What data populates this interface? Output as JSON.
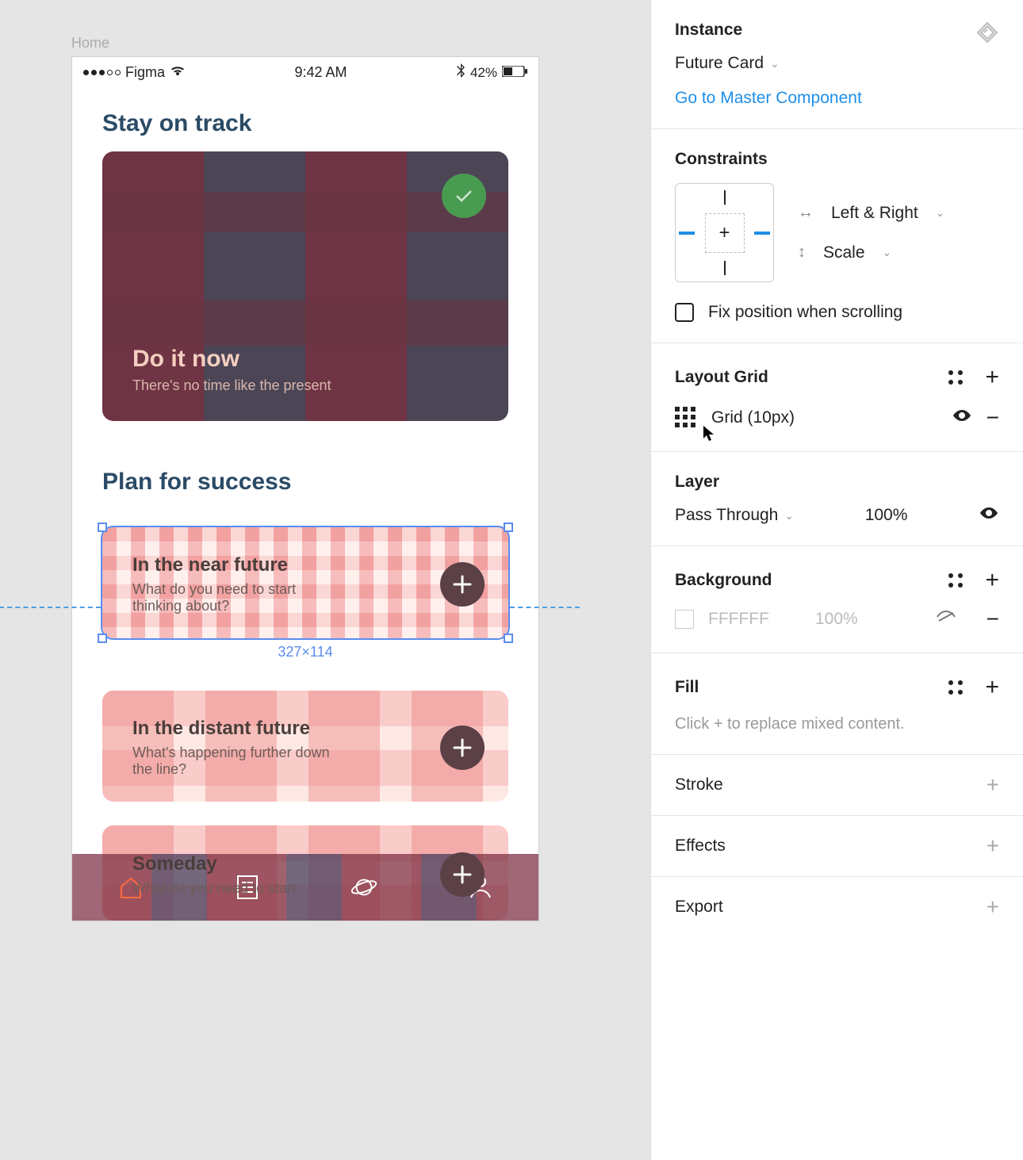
{
  "canvas": {
    "frame_label": "Home",
    "statusbar": {
      "carrier": "Figma",
      "time": "9:42 AM",
      "battery": "42%"
    },
    "section1_title": "Stay on track",
    "hero": {
      "title": "Do it now",
      "subtitle": "There's no time like the present"
    },
    "section2_title": "Plan for success",
    "cards": [
      {
        "title": "In the near future",
        "subtitle": "What do you need to start thinking about?"
      },
      {
        "title": "In the distant future",
        "subtitle": "What's happening further down the line?"
      },
      {
        "title": "Someday",
        "subtitle": "What do you need to start"
      }
    ],
    "selection_dim": "327×114"
  },
  "inspector": {
    "instance": {
      "title": "Instance",
      "component": "Future Card",
      "link": "Go to Master Component"
    },
    "constraints": {
      "title": "Constraints",
      "horizontal": "Left & Right",
      "vertical": "Scale",
      "fix_label": "Fix position when scrolling"
    },
    "layout_grid": {
      "title": "Layout Grid",
      "item": "Grid (10px)"
    },
    "layer": {
      "title": "Layer",
      "blend": "Pass Through",
      "opacity": "100%"
    },
    "background": {
      "title": "Background",
      "hex": "FFFFFF",
      "opacity": "100%"
    },
    "fill": {
      "title": "Fill",
      "hint": "Click + to replace mixed content."
    },
    "stroke": {
      "title": "Stroke"
    },
    "effects": {
      "title": "Effects"
    },
    "export": {
      "title": "Export"
    }
  }
}
